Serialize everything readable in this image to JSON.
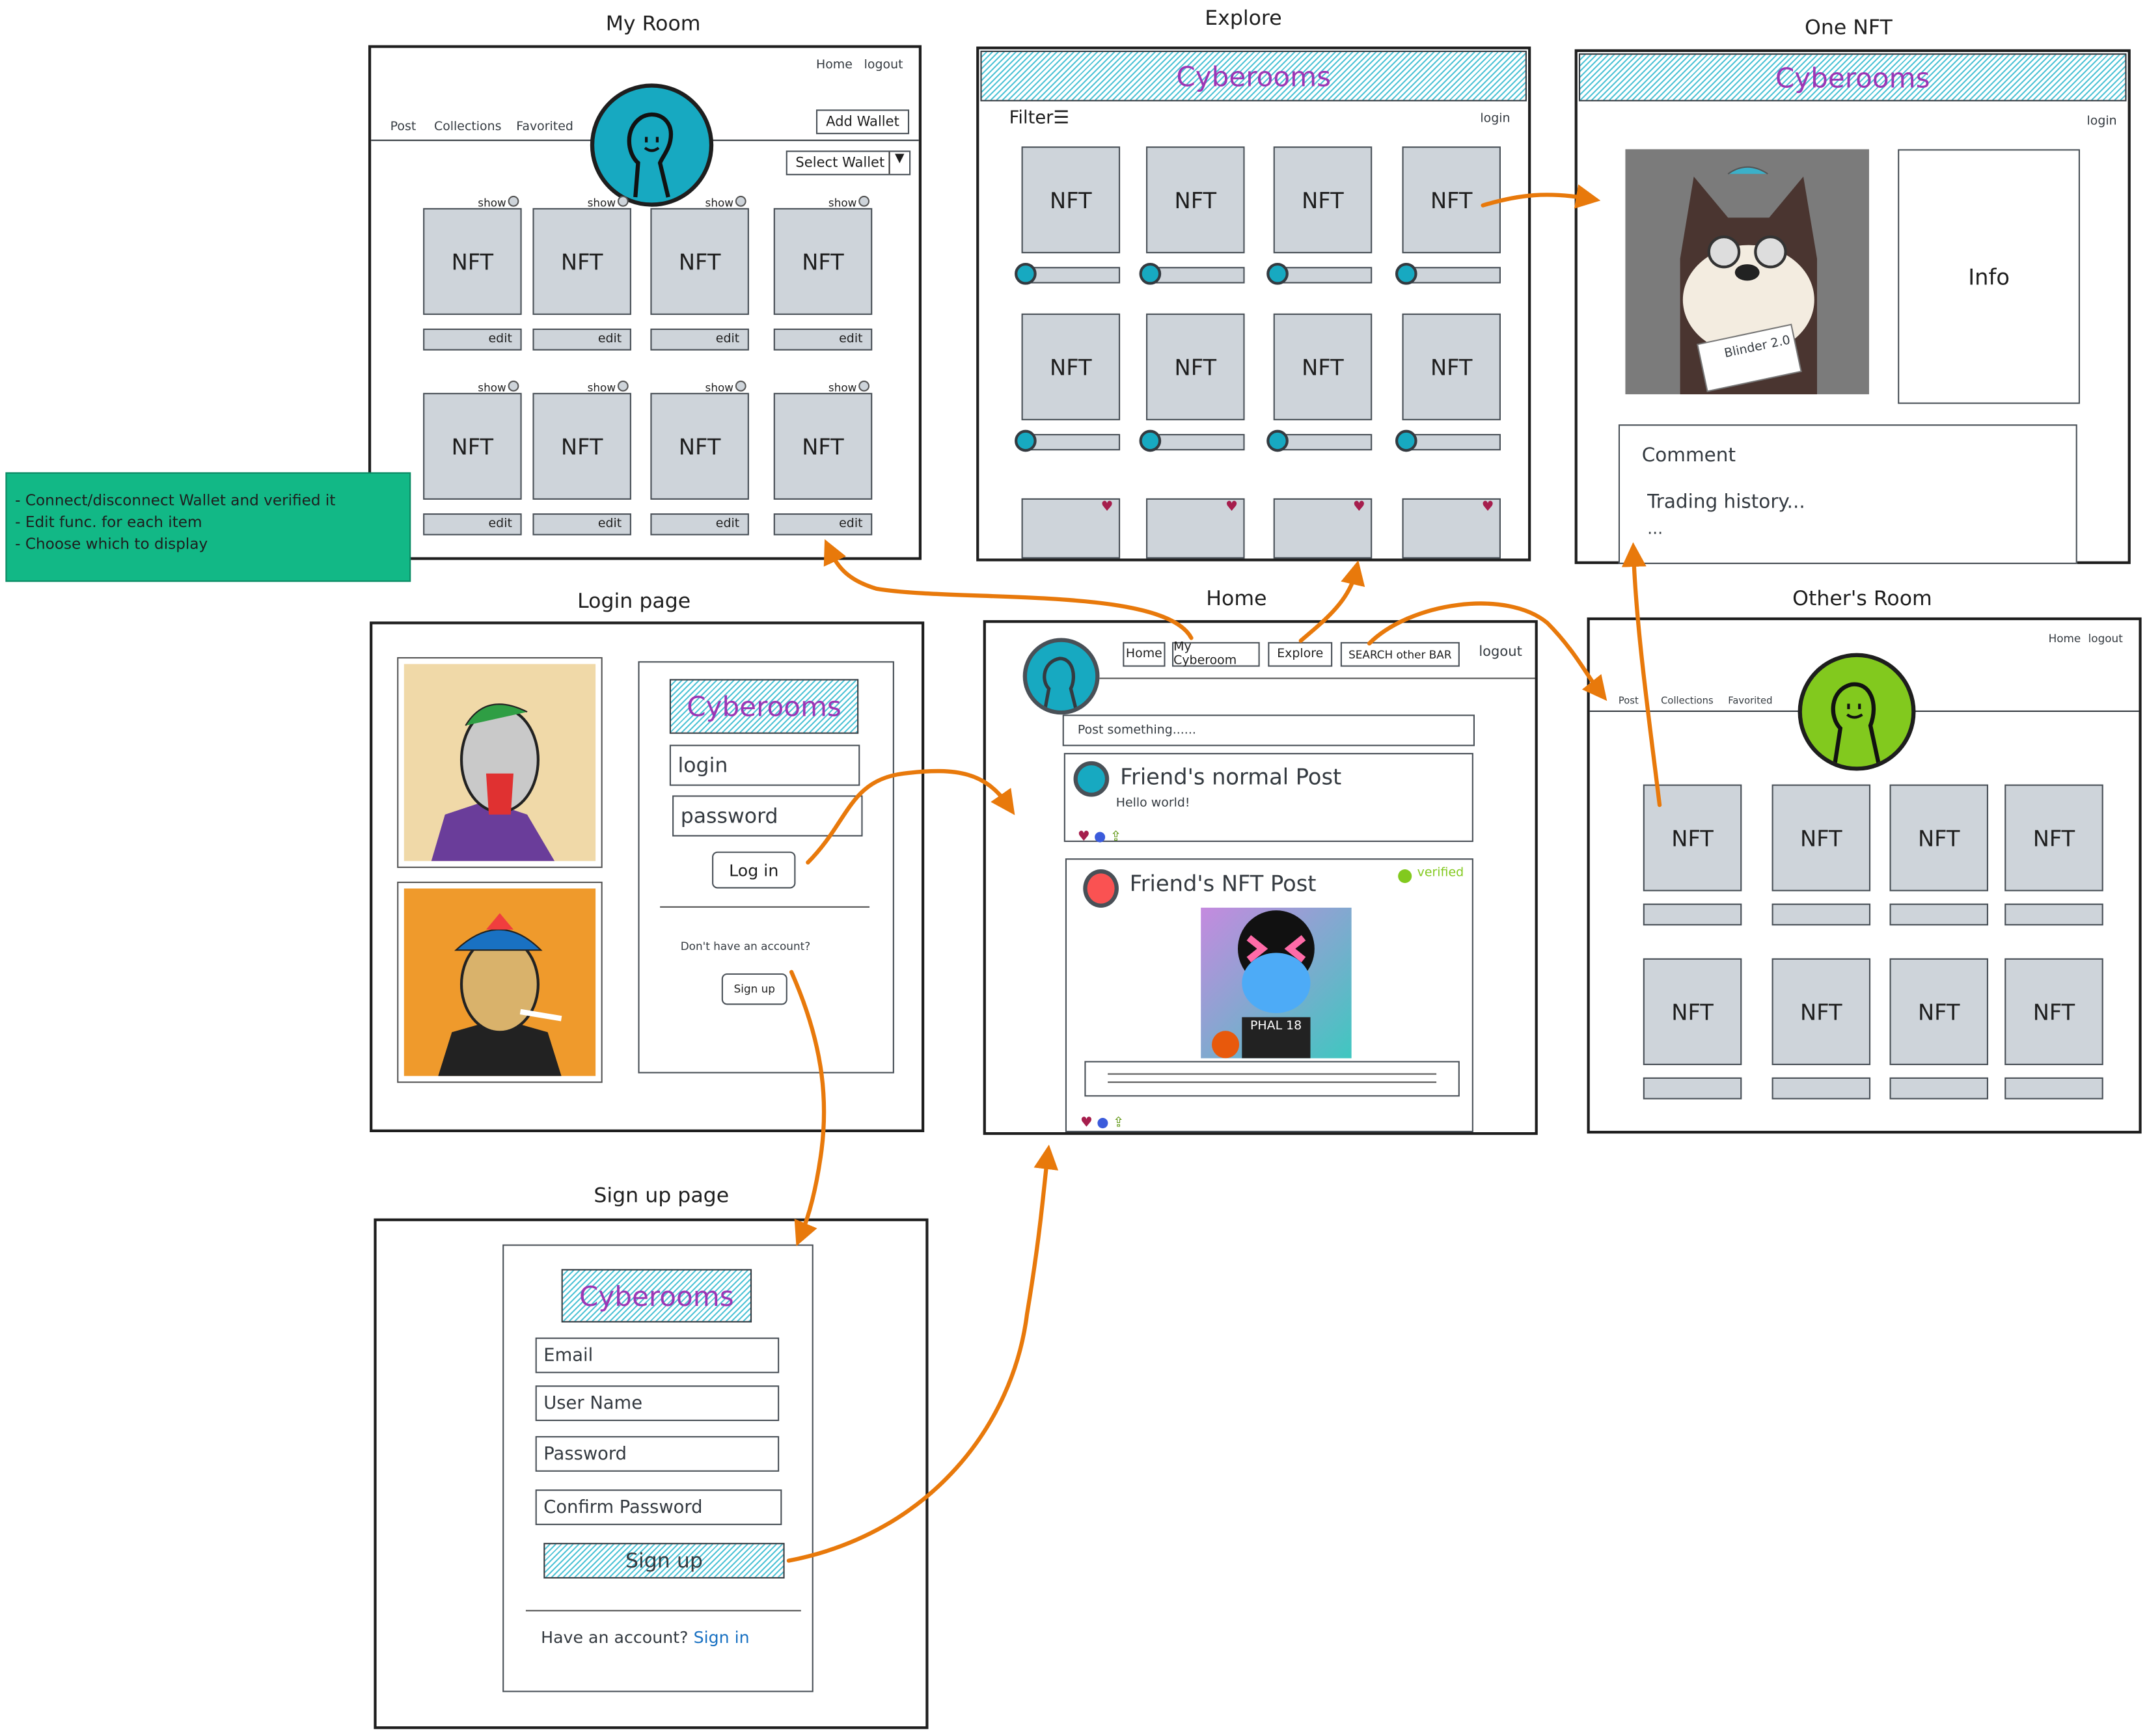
{
  "titles": {
    "my_room": "My Room",
    "explore": "Explore",
    "one_nft": "One NFT",
    "login": "Login page",
    "home": "Home",
    "others_room": "Other's Room",
    "signup": "Sign up page"
  },
  "brand": "Cyberooms",
  "note": {
    "lines": [
      "- Connect/disconnect Wallet and verified it",
      "- Edit func. for each item",
      "- Choose which to display"
    ],
    "color": "#12b886"
  },
  "colors": {
    "arrow": "#e8790b",
    "accent_teal": "#17a9c1",
    "brand_purple": "#9c36b5",
    "nft_gray": "#ced4da",
    "heart": "#a61e4d",
    "verified": "#82c91e"
  },
  "my_room": {
    "nav": [
      "Home",
      "logout"
    ],
    "tabs": [
      "Post",
      "Collections",
      "Favorited"
    ],
    "add_wallet": "Add Wallet",
    "select_wallet": "Select Wallet",
    "nft_label": "NFT",
    "show_label": "show",
    "edit_label": "edit"
  },
  "explore": {
    "filter": "Filter",
    "login": "login",
    "nft_label": "NFT"
  },
  "one_nft": {
    "login": "login",
    "info": "Info",
    "comment": "Comment",
    "trading": "Trading history...",
    "ellipsis": "...",
    "card_text": "Blinder 2.0"
  },
  "login_page": {
    "brand": "Cyberooms",
    "login_placeholder": "login",
    "password_placeholder": "password",
    "login_button": "Log in",
    "no_account": "Don't have an account?",
    "signup_button": "Sign up"
  },
  "home": {
    "nav": [
      "Home",
      "My Cyberoom",
      "Explore",
      "SEARCH other BAR"
    ],
    "logout": "logout",
    "post_placeholder": "Post something......",
    "normal_post": {
      "title": "Friend's normal Post",
      "body": "Hello world!"
    },
    "nft_post": {
      "title": "Friend's NFT Post",
      "verified": "verified",
      "jersey": "PHAL 18"
    }
  },
  "others_room": {
    "nav": [
      "Home",
      "logout"
    ],
    "tabs": [
      "Post",
      "Collections",
      "Favorited"
    ],
    "nft_label": "NFT"
  },
  "signup_page": {
    "brand": "Cyberooms",
    "fields": [
      "Email",
      "User Name",
      "Password",
      "Confirm Password"
    ],
    "button": "Sign up",
    "have_account": "Have an account?",
    "signin": "Sign in"
  }
}
